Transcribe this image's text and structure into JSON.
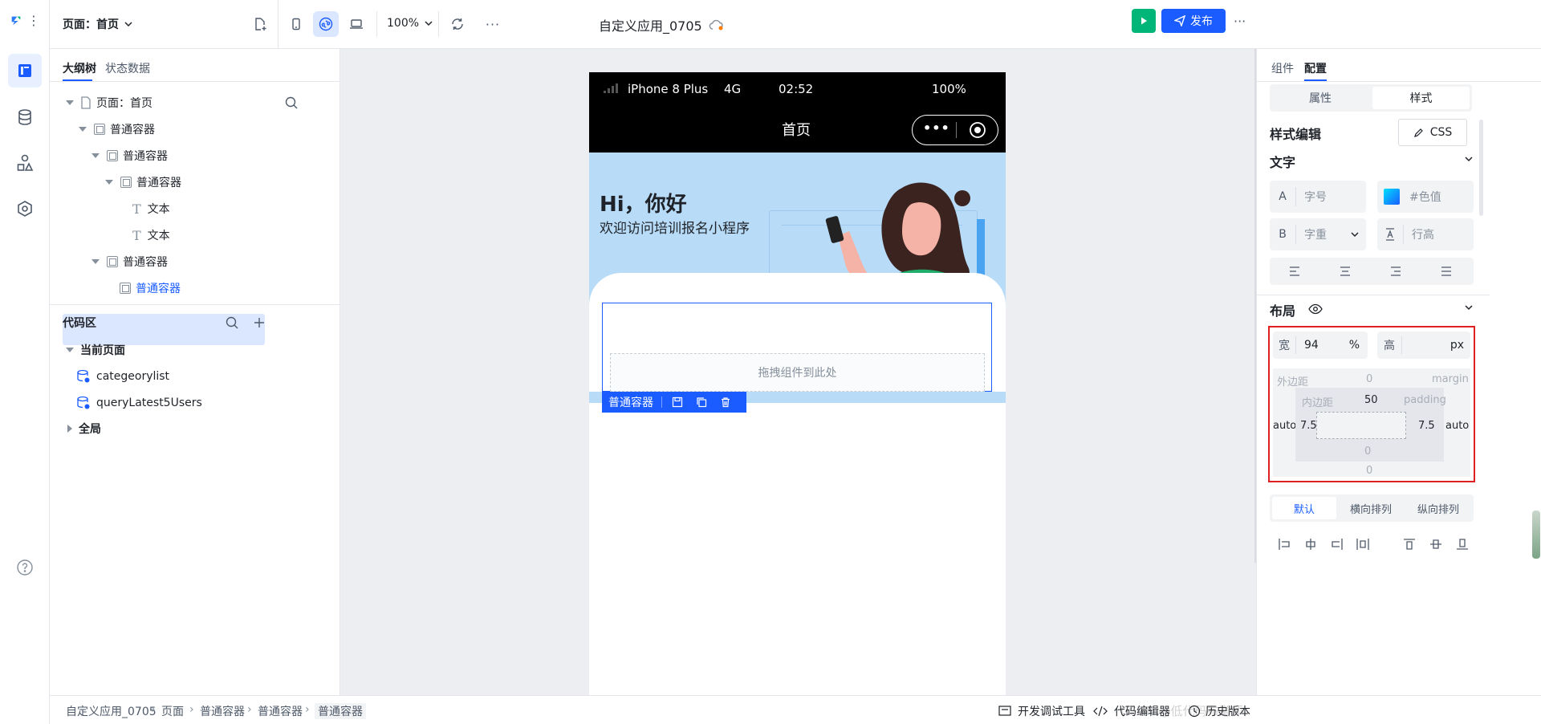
{
  "rail": {
    "items": [
      "outline-tree",
      "database",
      "components",
      "settings"
    ],
    "help": "help"
  },
  "topbar": {
    "page_selector": "页面：首页",
    "zoom": "100%",
    "app_title": "自定义应用_0705",
    "publish_label": "发布",
    "more": "···"
  },
  "left": {
    "tabs": [
      "大纲树",
      "状态数据"
    ],
    "tree": [
      {
        "label": "页面：首页"
      },
      {
        "label": "普通容器"
      },
      {
        "label": "普通容器"
      },
      {
        "label": "普通容器"
      },
      {
        "label": "文本"
      },
      {
        "label": "文本"
      },
      {
        "label": "普通容器"
      },
      {
        "label": "普通容器"
      }
    ],
    "code_title": "代码区",
    "code_current": "当前页面",
    "queries": [
      "categeorylist",
      "queryLatest5Users"
    ],
    "global": "全局"
  },
  "phone": {
    "device": "iPhone 8 Plus",
    "network": "4G",
    "time": "02:52",
    "battery": "100%",
    "nav_title": "首页",
    "hero_title": "Hi，你好",
    "hero_subtitle": "欢迎访问培训报名小程序",
    "drop_hint": "拖拽组件到此处",
    "selected_tag": "普通容器"
  },
  "right": {
    "tabs": [
      "组件",
      "配置"
    ],
    "seg": [
      "属性",
      "样式"
    ],
    "style_edit": "样式编辑",
    "css_btn": "CSS",
    "text_section": "文字",
    "font_size_ph": "字号",
    "color_ph": "#色值",
    "font_weight_ph": "字重",
    "line_height_ph": "行高",
    "layout_section": "布局",
    "width_label": "宽",
    "width_value": "94",
    "width_unit": "%",
    "height_label": "高",
    "height_unit": "px",
    "margin_label": "外边距",
    "margin_en": "margin",
    "margin_top": "0",
    "margin_bottom": "0",
    "margin_left": "auto",
    "margin_right": "auto",
    "padding_label": "内边距",
    "padding_en": "padding",
    "padding_top": "50",
    "padding_bottom": "0",
    "padding_left": "7.5",
    "padding_right": "7.5",
    "flex_tabs": [
      "默认",
      "横向排列",
      "纵向排列"
    ]
  },
  "bottombar": {
    "crumbs": [
      "自定义应用_0705",
      "页面",
      "普通容器",
      "普通容器",
      "普通容器"
    ],
    "devtools": "开发调试工具",
    "code_editor": "代码编辑器",
    "history": "历史版本",
    "watermark": "CSDN @低代码布道师"
  },
  "colors": {
    "primary": "#1a5cff",
    "run_green": "#00b578",
    "highlight_red": "#e02020",
    "selected_row": "#dbe6ff"
  }
}
